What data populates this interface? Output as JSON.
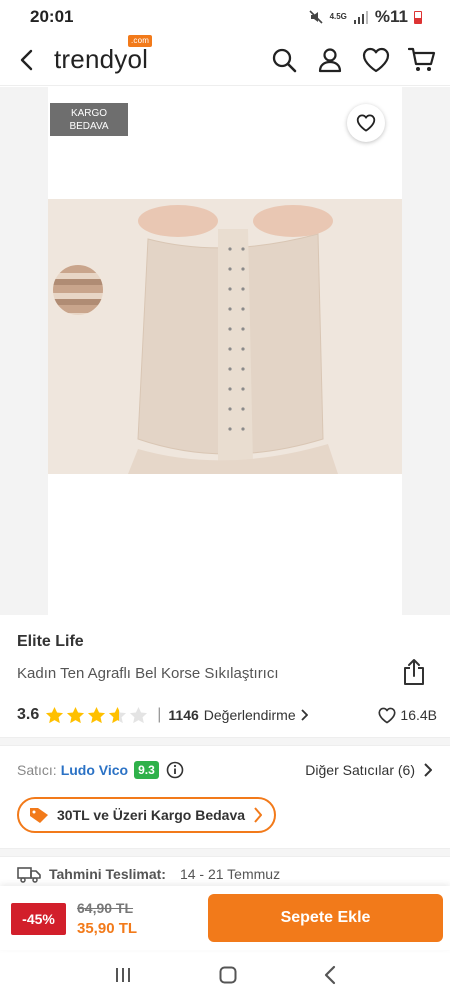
{
  "status_bar": {
    "time": "20:01",
    "network": "4.5G",
    "battery": "%11"
  },
  "header": {
    "logo": "trendyol",
    "logo_suffix": ".com"
  },
  "product_image": {
    "badge": "KARGO\nBEDAVA"
  },
  "product": {
    "brand": "Elite Life",
    "title": "Kadın Ten Agraflı Bel Korse Sıkılaştırıcı",
    "rating": "3.6",
    "stars": 3.6,
    "review_count": "1146",
    "review_label": "Değerlendirme",
    "likes": "16.4B"
  },
  "seller": {
    "label": "Satıcı:",
    "name": "Ludo Vico",
    "score": "9.3",
    "other_sellers": "Diğer Satıcılar (6)"
  },
  "promo": {
    "text": "30TL ve Üzeri Kargo Bedava"
  },
  "delivery": {
    "label": "Tahmini Teslimat:",
    "range": "14 - 21 Temmuz"
  },
  "bottom_bar": {
    "discount": "-45%",
    "old_price": "64,90 TL",
    "new_price": "35,90 TL",
    "add_to_cart": "Sepete Ekle"
  },
  "colors": {
    "brand_orange": "#f27a1a",
    "seller_blue": "#2b72c5",
    "score_green": "#2fb14a",
    "discount_red": "#d21f2b"
  }
}
